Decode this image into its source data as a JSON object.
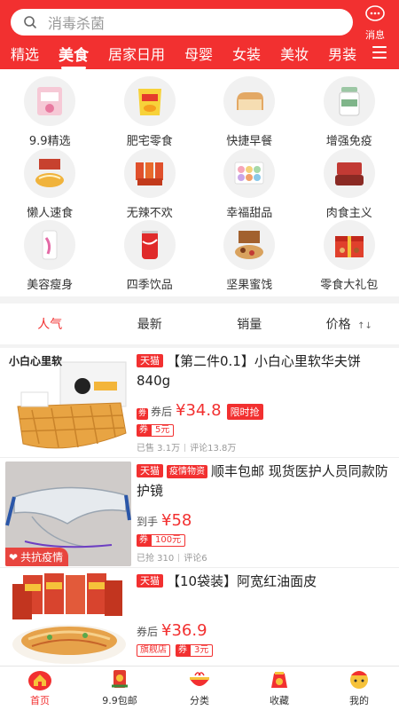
{
  "search": {
    "placeholder": "消毒杀菌"
  },
  "header": {
    "message_label": "消息"
  },
  "tabs": [
    "精选",
    "美食",
    "居家日用",
    "母婴",
    "女装",
    "美妆",
    "男装"
  ],
  "active_tab": "美食",
  "categories": [
    {
      "label": "9.9精选",
      "icon": "snack-pack-icon"
    },
    {
      "label": "肥宅零食",
      "icon": "chips-icon"
    },
    {
      "label": "快捷早餐",
      "icon": "bread-icon"
    },
    {
      "label": "增强免疫",
      "icon": "supplement-jar-icon"
    },
    {
      "label": "懒人速食",
      "icon": "noodles-icon"
    },
    {
      "label": "无辣不欢",
      "icon": "spicy-snack-icon"
    },
    {
      "label": "幸福甜品",
      "icon": "macaron-icon"
    },
    {
      "label": "肉食主义",
      "icon": "meat-icon"
    },
    {
      "label": "美容瘦身",
      "icon": "beauty-drink-icon"
    },
    {
      "label": "四季饮品",
      "icon": "cola-can-icon"
    },
    {
      "label": "坚果蜜饯",
      "icon": "nuts-icon"
    },
    {
      "label": "零食大礼包",
      "icon": "gift-box-icon"
    }
  ],
  "sort": {
    "items": [
      "人气",
      "最新",
      "销量",
      "价格"
    ],
    "active": "人气",
    "price_arrow": "↑↓"
  },
  "products": [
    {
      "platform": "天猫",
      "title": "【第二件0.1】小白心里软华夫饼840g",
      "price_label": "券后",
      "price_symbol": "¥",
      "price": "34.8",
      "limit_tag": "限时抢",
      "coupon_key": "券",
      "coupon_value": "5元",
      "sold": "已售 3.1万",
      "reviews": "评论13.8万",
      "image_brand": "小白心里软"
    },
    {
      "platform": "天猫",
      "epidemic_tag": "疫情物资",
      "title": "顺丰包邮 现货医护人员同款防护镜",
      "price_label": "到手",
      "price_symbol": "¥",
      "price": "58",
      "coupon_key": "券",
      "coupon_value": "100元",
      "sold": "已抢 310",
      "reviews": "评论6",
      "ribbon": "共抗疫情"
    },
    {
      "platform": "天猫",
      "title": "【10袋装】阿宽红油面皮",
      "price_label": "券后",
      "price_symbol": "¥",
      "price": "36.9",
      "store_tag": "旗舰店",
      "coupon_key": "券",
      "coupon_value": "3元"
    }
  ],
  "bottom_nav": [
    {
      "label": "首页",
      "icon": "home-icon",
      "active": true
    },
    {
      "label": "9.9包邮",
      "icon": "red-envelope-icon",
      "active": false
    },
    {
      "label": "分类",
      "icon": "bowl-icon",
      "active": false
    },
    {
      "label": "收藏",
      "icon": "fortune-bag-icon",
      "active": false
    },
    {
      "label": "我的",
      "icon": "mascot-icon",
      "active": false
    }
  ],
  "colors": {
    "brand": "#f23030",
    "text": "#333333",
    "muted": "#999999"
  }
}
